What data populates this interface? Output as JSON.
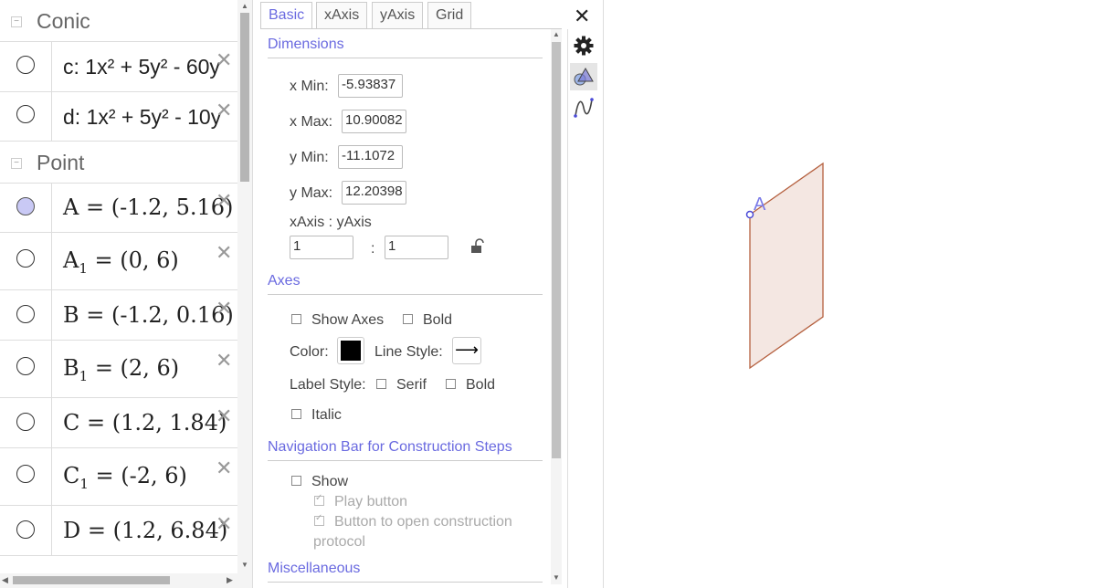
{
  "algebra": {
    "groups": [
      {
        "label": "Conic",
        "collapse": "−"
      },
      {
        "label": "Point",
        "collapse": "−"
      }
    ],
    "conics": [
      {
        "text": "c: 1x² + 5y² - 60y",
        "close": "✕"
      },
      {
        "text": "d: 1x² + 5y² - 10y",
        "close": "✕"
      }
    ],
    "points": [
      {
        "name": "A",
        "sub": "",
        "rest": " = (-1.2, 5.16)",
        "selected": true,
        "close": "✕"
      },
      {
        "name": "A",
        "sub": "1",
        "rest": " = (0, 6)",
        "selected": false,
        "close": "✕"
      },
      {
        "name": "B",
        "sub": "",
        "rest": " = (-1.2, 0.16)",
        "selected": false,
        "close": "✕"
      },
      {
        "name": "B",
        "sub": "1",
        "rest": " = (2, 6)",
        "selected": false,
        "close": "✕"
      },
      {
        "name": "C",
        "sub": "",
        "rest": " = (1.2, 1.84)",
        "selected": false,
        "close": "✕"
      },
      {
        "name": "C",
        "sub": "1",
        "rest": " = (-2, 6)",
        "selected": false,
        "close": "✕"
      },
      {
        "name": "D",
        "sub": "",
        "rest": " = (1.2, 6.84)",
        "selected": false,
        "close": "✕"
      }
    ]
  },
  "properties": {
    "tabs": [
      "Basic",
      "xAxis",
      "yAxis",
      "Grid"
    ],
    "active_tab": "Basic",
    "close": "✕",
    "dimensions": {
      "title": "Dimensions",
      "xmin_label": "x Min:",
      "xmin_value": "-5.93837",
      "xmax_label": "x Max:",
      "xmax_value": "10.90082",
      "ymin_label": "y Min:",
      "ymin_value": "-11.1072",
      "ymax_label": "y Max:",
      "ymax_value": "12.20398",
      "ratio_label": "xAxis : yAxis",
      "ratio_x": "1",
      "ratio_sep": ":",
      "ratio_y": "1"
    },
    "axes": {
      "title": "Axes",
      "show_axes": "Show Axes",
      "bold": "Bold",
      "color_label": "Color:",
      "color_value": "#000000",
      "line_style_label": "Line Style:",
      "line_style_glyph": "⟶",
      "label_style_label": "Label Style:",
      "serif": "Serif",
      "bold2": "Bold",
      "italic": "Italic"
    },
    "navigation": {
      "title": "Navigation Bar for Construction Steps",
      "show": "Show",
      "play": "Play button",
      "open_protocol_1": "Button to open construction",
      "open_protocol_2": "protocol"
    },
    "misc": {
      "title": "Miscellaneous"
    }
  },
  "graphics": {
    "point_label": "A",
    "fill_color": "#f4e7e2",
    "edge_color": "#b5603f",
    "point_color": "#4a4ad8"
  },
  "colors": {
    "accent": "#6a6ae0"
  }
}
